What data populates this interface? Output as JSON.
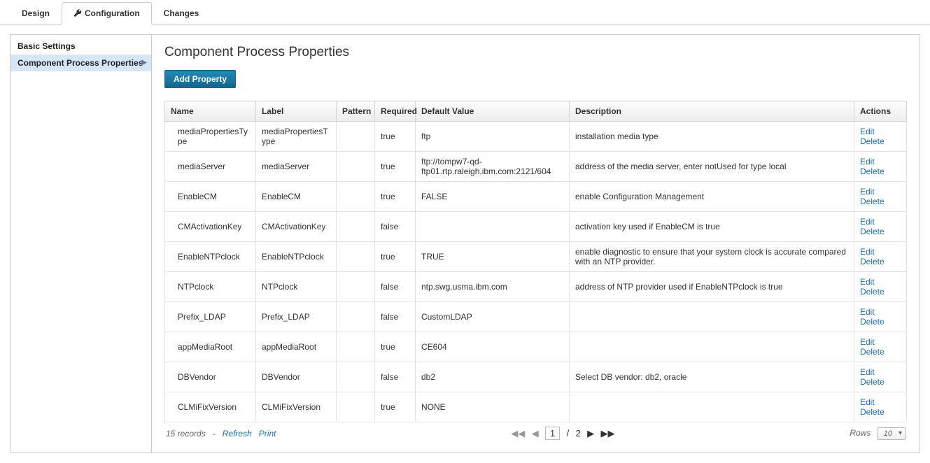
{
  "tabs": {
    "design": "Design",
    "configuration": "Configuration",
    "changes": "Changes"
  },
  "sidebar": {
    "basic_settings": "Basic Settings",
    "component_process_properties": "Component Process Properties"
  },
  "page": {
    "title": "Component Process Properties",
    "add_property_btn": "Add Property"
  },
  "columns": {
    "name": "Name",
    "label": "Label",
    "pattern": "Pattern",
    "required": "Required",
    "default_value": "Default Value",
    "description": "Description",
    "actions": "Actions"
  },
  "actions": {
    "edit": "Edit",
    "delete": "Delete"
  },
  "rows": [
    {
      "name": "mediaPropertiesType",
      "label": "mediaPropertiesType",
      "pattern": "",
      "required": "true",
      "default": "ftp",
      "description": "installation media type"
    },
    {
      "name": "mediaServer",
      "label": "mediaServer",
      "pattern": "",
      "required": "true",
      "default": "ftp://tompw7-qd-ftp01.rtp.raleigh.ibm.com:2121/604",
      "description": "address of the media server, enter notUsed for type local"
    },
    {
      "name": "EnableCM",
      "label": "EnableCM",
      "pattern": "",
      "required": "true",
      "default": "FALSE",
      "description": "enable Configuration Management"
    },
    {
      "name": "CMActivationKey",
      "label": "CMActivationKey",
      "pattern": "",
      "required": "false",
      "default": "",
      "description": "activation key used if EnableCM is true"
    },
    {
      "name": "EnableNTPclock",
      "label": "EnableNTPclock",
      "pattern": "",
      "required": "true",
      "default": "TRUE",
      "description": "enable diagnostic to ensure that your system clock is accurate compared with an NTP provider."
    },
    {
      "name": "NTPclock",
      "label": "NTPclock",
      "pattern": "",
      "required": "false",
      "default": "ntp.swg.usma.ibm.com",
      "description": "address of NTP provider used if EnableNTPclock is true"
    },
    {
      "name": "Prefix_LDAP",
      "label": "Prefix_LDAP",
      "pattern": "",
      "required": "false",
      "default": "CustomLDAP",
      "description": ""
    },
    {
      "name": "appMediaRoot",
      "label": "appMediaRoot",
      "pattern": "",
      "required": "true",
      "default": "CE604",
      "description": ""
    },
    {
      "name": "DBVendor",
      "label": "DBVendor",
      "pattern": "",
      "required": "false",
      "default": "db2",
      "description": "Select DB vendor: db2, oracle"
    },
    {
      "name": "CLMiFixVersion",
      "label": "CLMiFixVersion",
      "pattern": "",
      "required": "true",
      "default": "NONE",
      "description": ""
    }
  ],
  "footer": {
    "records": "15 records",
    "separator": "-",
    "refresh": "Refresh",
    "print": "Print",
    "current_page": "1",
    "total_pages": "2",
    "rows_label": "Rows",
    "rows_value": "10"
  }
}
